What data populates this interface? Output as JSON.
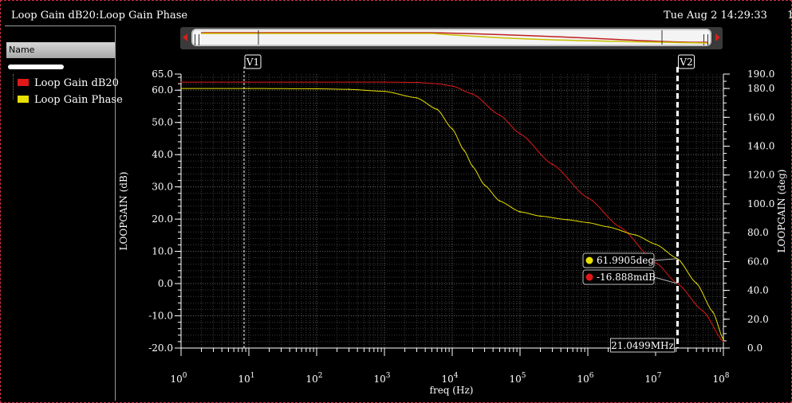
{
  "window": {
    "title": "Loop Gain dB20:Loop Gain Phase",
    "date": "Tue Aug 2 14:29:33",
    "date_suffix": "1"
  },
  "sidebar": {
    "header": "Name",
    "items": [
      {
        "label": "Loop Gain dB20",
        "color": "#e01818"
      },
      {
        "label": "Loop Gain Phase",
        "color": "#e8e000"
      }
    ]
  },
  "markers": {
    "v1_label": "V1",
    "v2_label": "V2",
    "v1_freq": 8.5,
    "v2_freq": 21049900,
    "v2_readout": "21.0499MHz",
    "phase_readout": "61.9905deg",
    "gain_readout": "-16.888mdB",
    "phase_color": "#e8e000",
    "gain_color": "#e01818"
  },
  "chart_data": {
    "type": "line",
    "xlabel": "freq (Hz)",
    "ylabel_left": "LOOPGAIN (dB)",
    "ylabel_right": "LOOPGAIN (deg)",
    "xscale": "log",
    "xlim": [
      1,
      100000000
    ],
    "ylim_left": [
      -20.0,
      65.0
    ],
    "ylim_right": [
      0.0,
      190.0
    ],
    "x_tick_exponents": [
      0,
      1,
      2,
      3,
      4,
      5,
      6,
      7,
      8
    ],
    "x_tick_base": "10",
    "y_ticks_left": [
      "65.0",
      "60.0",
      "50.0",
      "40.0",
      "30.0",
      "20.0",
      "10.0",
      "0.0",
      "-10.0",
      "-20.0"
    ],
    "y_tick_values_left": [
      65,
      60,
      50,
      40,
      30,
      20,
      10,
      0,
      -10,
      -20
    ],
    "y_ticks_right": [
      "190.0",
      "180.0",
      "160.0",
      "140.0",
      "120.0",
      "100.0",
      "80.0",
      "60.0",
      "40.0",
      "20.0",
      "0.0"
    ],
    "y_tick_values_right": [
      190,
      180,
      160,
      140,
      120,
      100,
      80,
      60,
      40,
      20,
      0
    ],
    "grid": true,
    "series": [
      {
        "name": "Loop Gain dB20",
        "axis": "left",
        "color": "#e01818",
        "x": [
          1,
          10,
          100,
          1000,
          3000,
          6000,
          10000,
          20000,
          50000,
          100000,
          300000,
          1000000,
          3000000,
          10000000,
          21049900,
          50000000,
          100000000
        ],
        "y": [
          62.5,
          62.5,
          62.5,
          62.5,
          62.4,
          62.0,
          61.3,
          58.8,
          52.3,
          46.5,
          37.0,
          26.6,
          17.5,
          6.5,
          0.0,
          -8.5,
          -18.0
        ]
      },
      {
        "name": "Loop Gain Phase",
        "axis": "right",
        "color": "#e8e000",
        "x": [
          1,
          10,
          100,
          300,
          1000,
          3000,
          6000,
          10000,
          15000,
          20000,
          30000,
          50000,
          100000,
          200000,
          500000,
          1000000,
          2000000,
          5000000,
          10000000,
          21049900,
          40000000,
          70000000,
          100000000
        ],
        "y": [
          180.0,
          180.0,
          179.8,
          179.4,
          178.0,
          173.5,
          165.5,
          152.0,
          137.0,
          126.0,
          113.0,
          102.0,
          94.5,
          91.5,
          89.0,
          87.0,
          84.0,
          78.5,
          72.0,
          62.0,
          45.0,
          25.0,
          6.0
        ]
      }
    ]
  }
}
